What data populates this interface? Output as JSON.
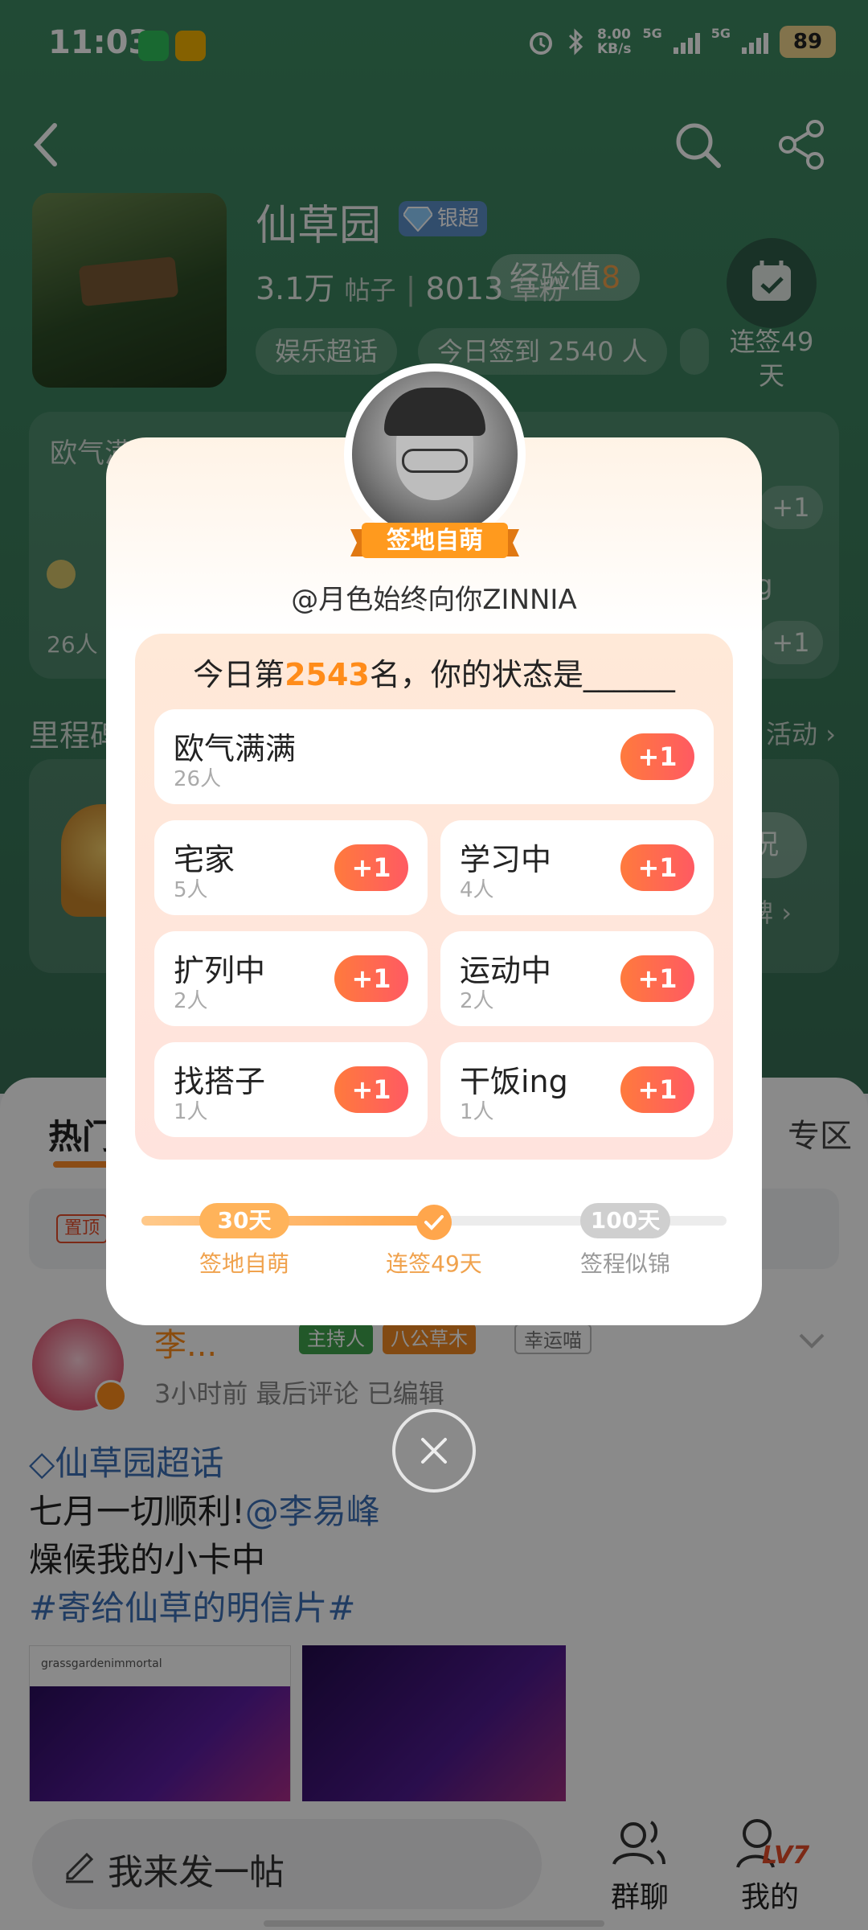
{
  "status_bar": {
    "time": "11:03",
    "net_speed_top": "8.00",
    "net_speed_unit": "KB/s",
    "signal_1": "5G",
    "signal_2": "5G",
    "battery": "89"
  },
  "nav": {
    "back_icon": "chevron-left-icon",
    "search_icon": "search-icon",
    "share_icon": "share-icon"
  },
  "topic": {
    "title": "仙草园",
    "badge": "银超",
    "posts_count": "3.1万",
    "posts_label": "帖子",
    "sep": "|",
    "readers_count": "8013",
    "readers_label": "草粉",
    "exp_label": "经验值",
    "exp_value": "8",
    "chips": [
      "娱乐超话",
      "今日签到 2540 人"
    ],
    "checkin_text_1": "连签49",
    "checkin_text_2": "天"
  },
  "bg_card": {
    "tag1": "欧气满满",
    "plus": "+1",
    "count": "26人",
    "ing": "g",
    "mile_title": "里程碑",
    "mile_more": "活动",
    "mile_btn": "况",
    "mile_pillar": "碑"
  },
  "feed": {
    "tab": "热门",
    "right_label": "专区",
    "pin": "置顶",
    "poster_name": "李...",
    "badges": [
      "主持人",
      "八公草木",
      "幸运喵"
    ],
    "meta": "3小时前 最后评论  已编辑",
    "topic_link": "仙草园超话",
    "line2_a": "七月一切顺利!",
    "line2_b": "@李易峰",
    "line3": "燥候我的小卡中",
    "hashtag": "#寄给仙草的明信片#",
    "img_caption": "grassgardenimmortal"
  },
  "bottom": {
    "compose_placeholder": "我来发一帖",
    "group_chat": "群聊",
    "mine": "我的",
    "level": "LV7"
  },
  "modal": {
    "rank_title": "签地自萌",
    "username": "@月色始终向你ZINNIA",
    "question_a": "今日第",
    "rank_num": "2543",
    "question_b": "名，你的状态是______",
    "options": [
      {
        "name": "欧气满满",
        "count": "26人",
        "plus": "+1"
      },
      {
        "name": "宅家",
        "count": "5人",
        "plus": "+1"
      },
      {
        "name": "学习中",
        "count": "4人",
        "plus": "+1"
      },
      {
        "name": "扩列中",
        "count": "2人",
        "plus": "+1"
      },
      {
        "name": "运动中",
        "count": "2人",
        "plus": "+1"
      },
      {
        "name": "找搭子",
        "count": "1人",
        "plus": "+1"
      },
      {
        "name": "干饭ing",
        "count": "1人",
        "plus": "+1"
      }
    ],
    "milestones": [
      {
        "days": "30天",
        "label": "签地自萌",
        "state": "reached"
      },
      {
        "days": "",
        "label": "连签49天",
        "state": "current"
      },
      {
        "days": "100天",
        "label": "签程似锦",
        "state": "future"
      }
    ],
    "progress_fraction": 0.5
  },
  "colors": {
    "accent_orange": "#ff8c1a",
    "plus_gradient_start": "#ff7a3d",
    "plus_gradient_end": "#ff5a62",
    "header_green": "#3e8a62"
  }
}
